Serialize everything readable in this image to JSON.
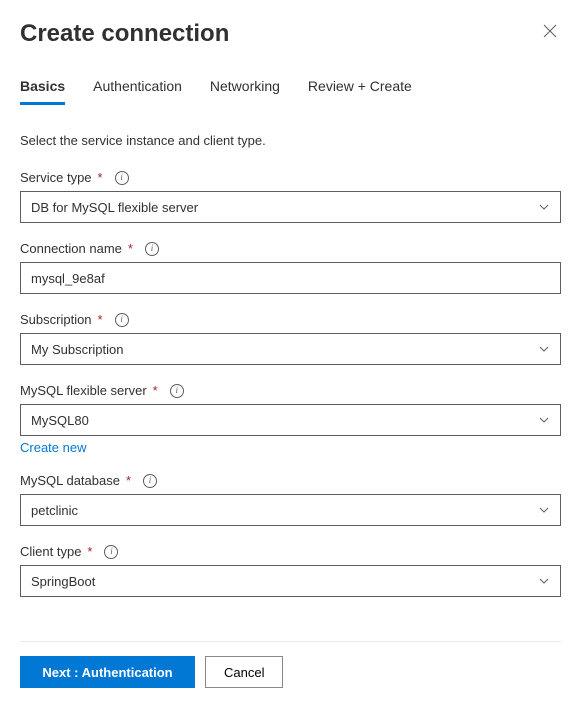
{
  "header": {
    "title": "Create connection"
  },
  "tabs": [
    {
      "label": "Basics",
      "active": true
    },
    {
      "label": "Authentication",
      "active": false
    },
    {
      "label": "Networking",
      "active": false
    },
    {
      "label": "Review + Create",
      "active": false
    }
  ],
  "intro": "Select the service instance and client type.",
  "fields": {
    "serviceType": {
      "label": "Service type",
      "value": "DB for MySQL flexible server"
    },
    "connectionName": {
      "label": "Connection name",
      "value": "mysql_9e8af"
    },
    "subscription": {
      "label": "Subscription",
      "value": "My Subscription"
    },
    "flexServer": {
      "label": "MySQL flexible server",
      "value": "MySQL80",
      "createNew": "Create new"
    },
    "database": {
      "label": "MySQL database",
      "value": "petclinic"
    },
    "clientType": {
      "label": "Client type",
      "value": "SpringBoot"
    }
  },
  "footer": {
    "next": "Next : Authentication",
    "cancel": "Cancel"
  }
}
